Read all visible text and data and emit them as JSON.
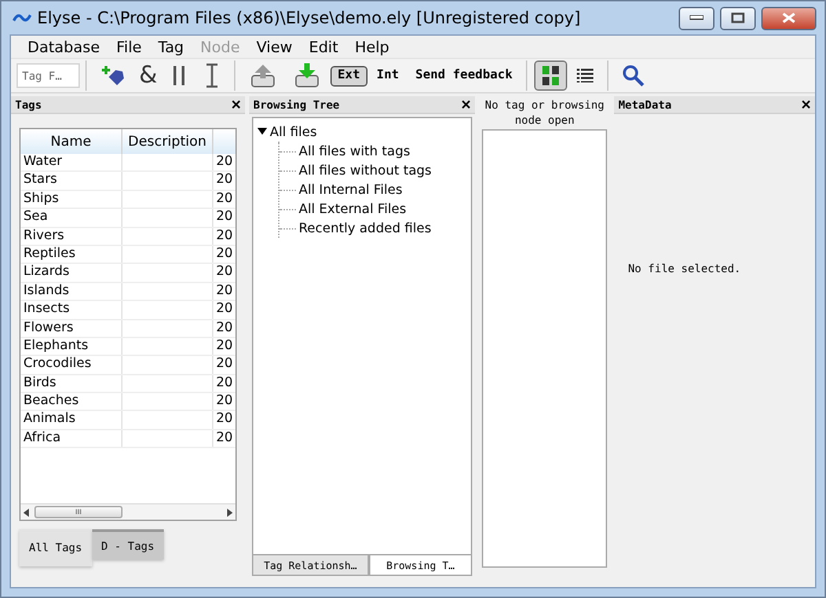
{
  "window": {
    "title": "Elyse - C:\\Program Files (x86)\\Elyse\\demo.ely [Unregistered copy]"
  },
  "menu": [
    {
      "label": "Database",
      "disabled": false
    },
    {
      "label": "File",
      "disabled": false
    },
    {
      "label": "Tag",
      "disabled": false
    },
    {
      "label": "Node",
      "disabled": true
    },
    {
      "label": "View",
      "disabled": false
    },
    {
      "label": "Edit",
      "disabled": false
    },
    {
      "label": "Help",
      "disabled": false
    }
  ],
  "toolbar": {
    "tag_filter": {
      "placeholder": "Tag F…"
    },
    "and_button": "&",
    "ext_button": {
      "label": "Ext",
      "selected": true
    },
    "int_button": {
      "label": "Int",
      "selected": false
    },
    "feedback": "Send feedback",
    "views": [
      {
        "kind": "grid",
        "selected": true
      },
      {
        "kind": "list",
        "selected": false
      }
    ]
  },
  "tags_panel": {
    "title": "Tags",
    "close": "×",
    "columns": [
      "Name",
      "Description"
    ],
    "rows": [
      {
        "name": "Water",
        "column_3": "20"
      },
      {
        "name": "Stars",
        "column_3": "20"
      },
      {
        "name": "Ships",
        "column_3": "20"
      },
      {
        "name": "Sea",
        "column_3": "20"
      },
      {
        "name": "Rivers",
        "column_3": "20"
      },
      {
        "name": "Reptiles",
        "column_3": "20"
      },
      {
        "name": "Lizards",
        "column_3": "20"
      },
      {
        "name": "Islands",
        "column_3": "20"
      },
      {
        "name": "Insects",
        "column_3": "20"
      },
      {
        "name": "Flowers",
        "column_3": "20"
      },
      {
        "name": "Elephants",
        "column_3": "20"
      },
      {
        "name": "Crocodiles",
        "column_3": "20"
      },
      {
        "name": "Birds",
        "column_3": "20"
      },
      {
        "name": "Beaches",
        "column_3": "20"
      },
      {
        "name": "Animals",
        "column_3": "20"
      },
      {
        "name": "Africa",
        "column_3": "20"
      }
    ],
    "scroll_grip": "III",
    "tabs": [
      {
        "label": "All Tags",
        "selected": true
      },
      {
        "label": "D - Tags",
        "selected": false
      }
    ]
  },
  "browsing_panel": {
    "title": "Browsing Tree",
    "close": "×",
    "tree": [
      {
        "label": "All files",
        "expanded": true,
        "children": [
          {
            "label": "All files with tags"
          },
          {
            "label": "All files without tags"
          },
          {
            "label": "All Internal Files"
          },
          {
            "label": "All External Files"
          },
          {
            "label": "Recently added files"
          }
        ]
      }
    ],
    "tabs": [
      {
        "label": "Tag Relationsh…",
        "selected": false
      },
      {
        "label": "Browsing T…",
        "selected": true
      }
    ]
  },
  "node_panel": {
    "message": "No tag or browsing node open"
  },
  "metadata_panel": {
    "title": "MetaData",
    "close": "×",
    "message": "No file selected."
  }
}
